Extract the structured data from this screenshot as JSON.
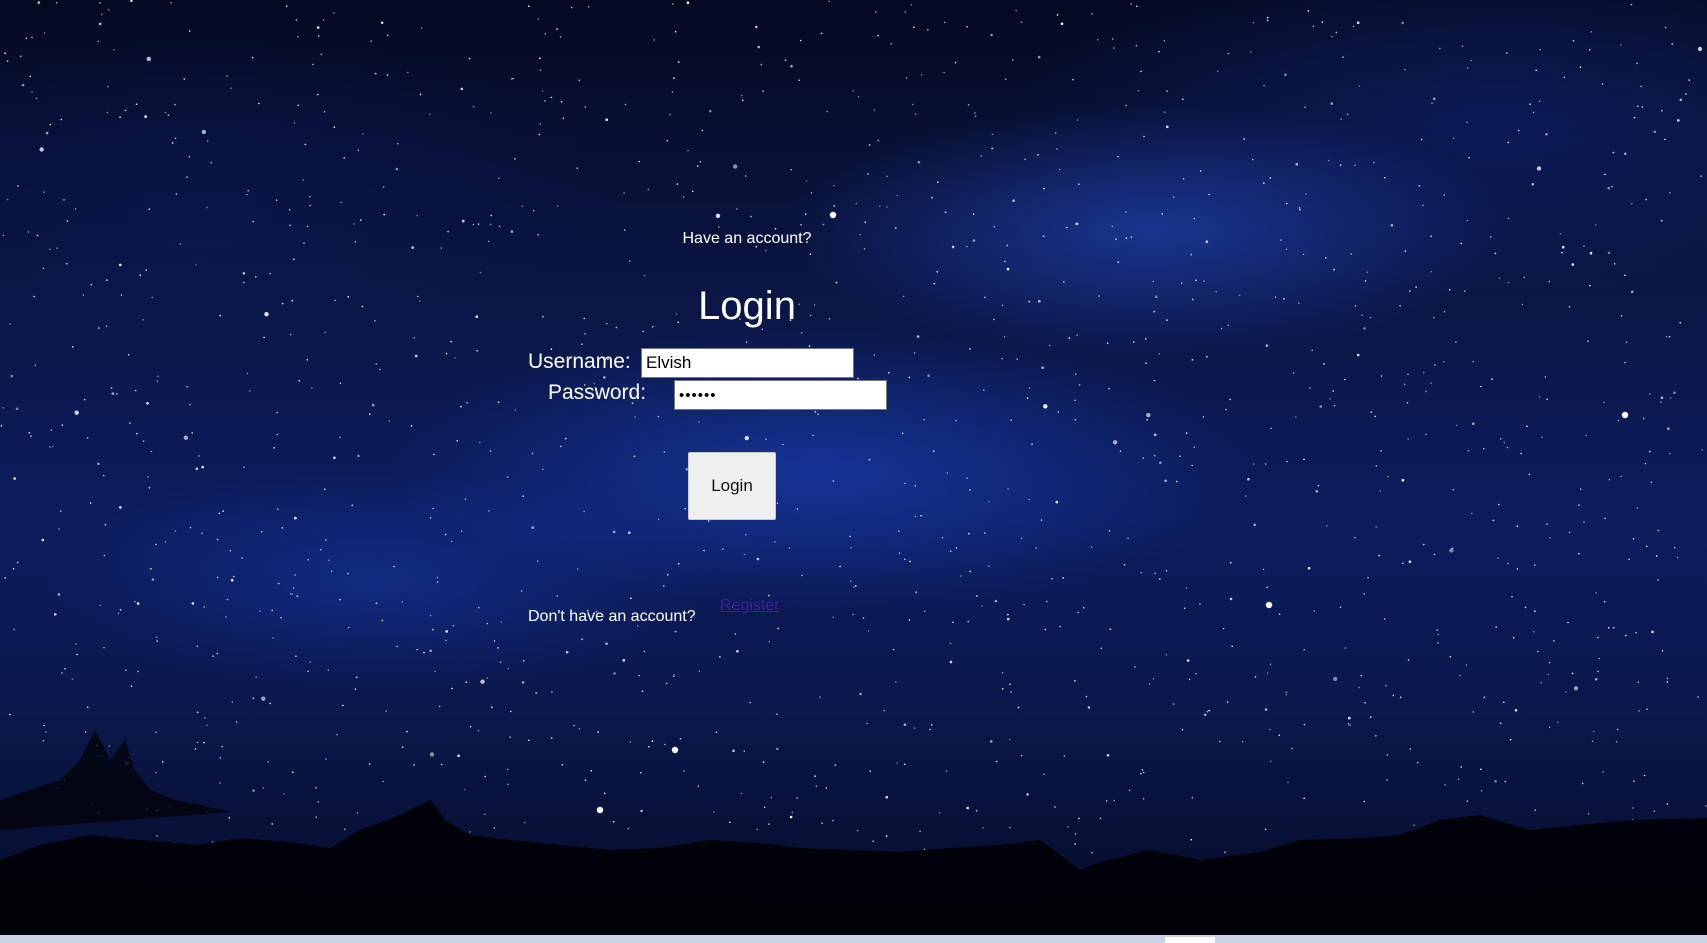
{
  "login": {
    "have_account_text": "Have an account?",
    "title": "Login",
    "username_label": "Username:",
    "username_value": "Elvish",
    "password_label": "Password:",
    "password_value": "••••••",
    "button_label": "Login",
    "no_account_text": "Don't have an account?",
    "register_link_text": "Register"
  },
  "colors": {
    "sky_top": "#050a22",
    "sky_mid": "#0c1d5e",
    "text": "#ffffff",
    "register_link": "#3a1f96",
    "button_bg": "#efefef"
  }
}
